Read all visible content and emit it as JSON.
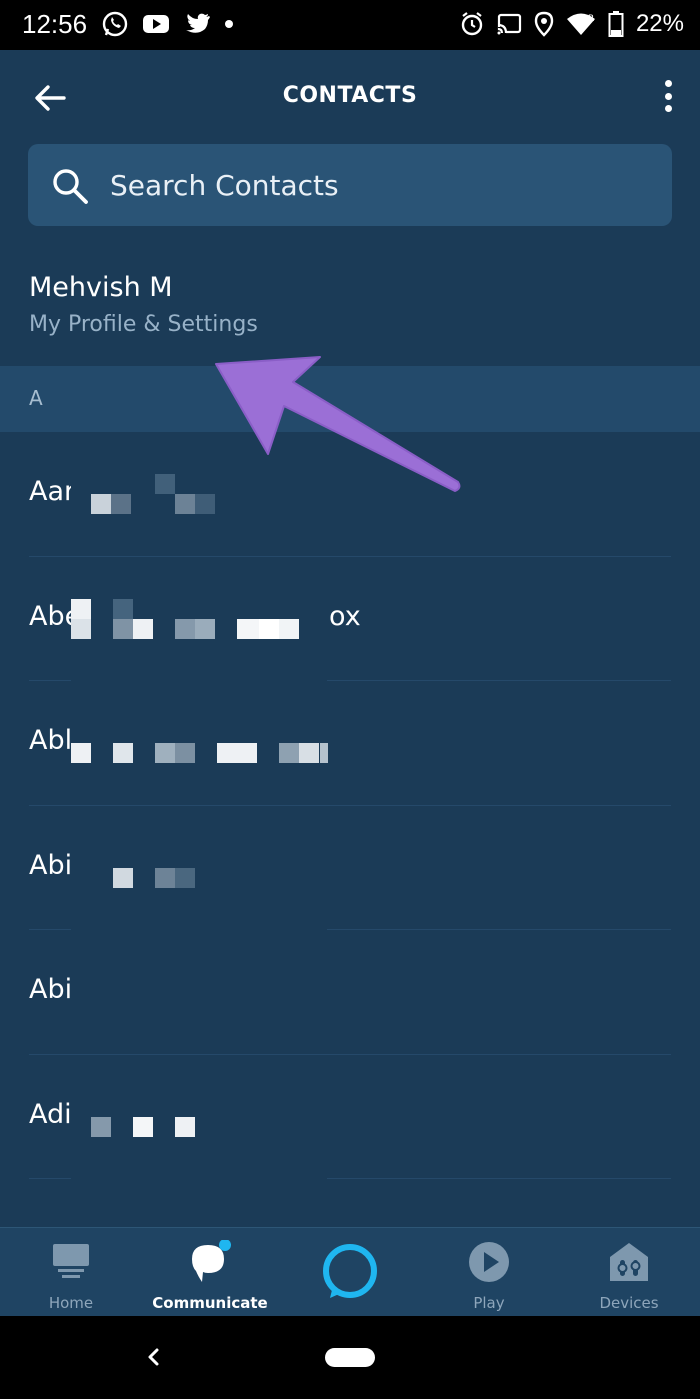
{
  "status_bar": {
    "time": "12:56",
    "left_icons": [
      "whatsapp-icon",
      "youtube-icon",
      "twitter-icon",
      "dot-icon"
    ],
    "right_icons": [
      "alarm-icon",
      "cast-icon",
      "location-icon",
      "wifi-icon",
      "battery-icon"
    ],
    "battery": "22%"
  },
  "app_bar": {
    "title": "CONTACTS"
  },
  "search": {
    "placeholder": "Search Contacts"
  },
  "profile": {
    "name": "Mehvish M",
    "subtitle": "My Profile & Settings"
  },
  "section": {
    "letter": "A"
  },
  "contacts": [
    {
      "name": "Aar",
      "suffix": ""
    },
    {
      "name": "Abe",
      "suffix": "ox"
    },
    {
      "name": "Abl",
      "suffix": ""
    },
    {
      "name": "Abi",
      "suffix": ""
    },
    {
      "name": "Abi",
      "suffix": ""
    },
    {
      "name": "Adi",
      "suffix": ""
    }
  ],
  "bottom_nav": {
    "items": [
      {
        "label": "Home",
        "icon": "home-icon",
        "active": false
      },
      {
        "label": "Communicate",
        "icon": "chat-bubble-icon",
        "active": true
      },
      {
        "label": "",
        "icon": "alexa-ring-icon",
        "active": false
      },
      {
        "label": "Play",
        "icon": "play-icon",
        "active": false
      },
      {
        "label": "Devices",
        "icon": "devices-icon",
        "active": false
      }
    ]
  },
  "colors": {
    "background": "#1b3b57",
    "search_box": "#2a5476",
    "section_header": "#234a6b",
    "alexa_accent": "#1fb6f0",
    "annotation_arrow": "#9b6fd6"
  }
}
